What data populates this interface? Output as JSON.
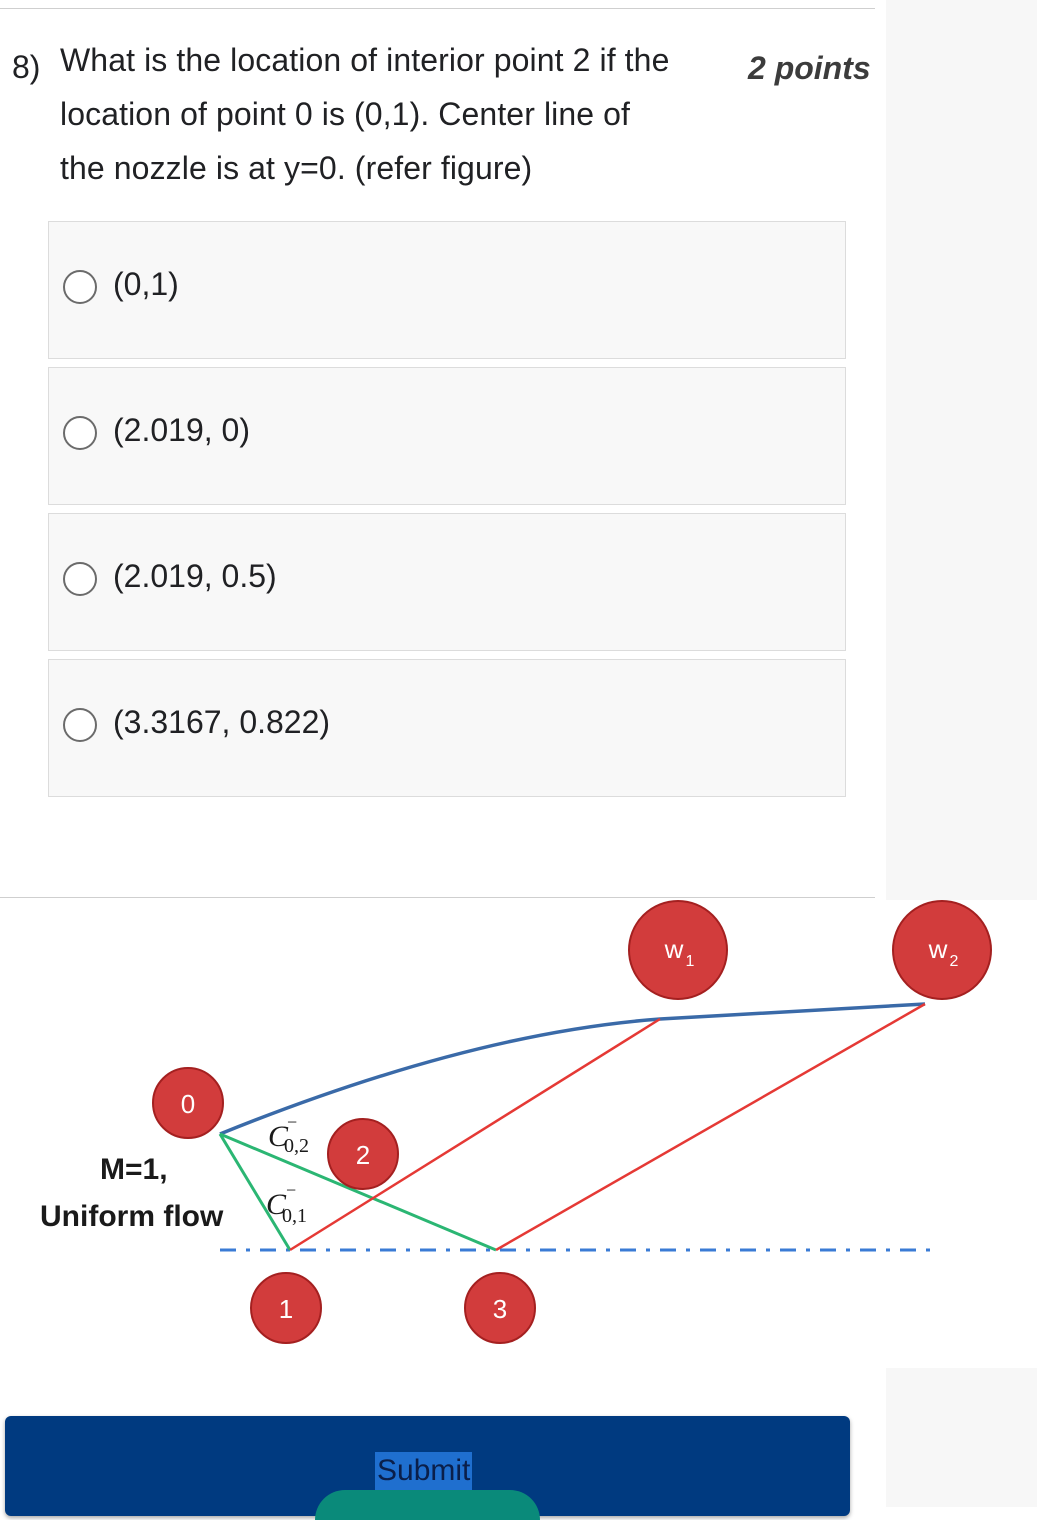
{
  "question": {
    "number": "8)",
    "lines": [
      "What is the location of interior point 2 if the",
      "location of point 0 is (0,1).  Center line of",
      "the nozzle is at y=0. (refer figure)"
    ],
    "points": "2 points"
  },
  "options": [
    {
      "label": "(0,1)"
    },
    {
      "label": "(2.019, 0)"
    },
    {
      "label": "(2.019, 0.5)"
    },
    {
      "label": "(3.3167, 0.822)"
    }
  ],
  "figure": {
    "inflow_label_1": "M=1,",
    "inflow_label_2": "Uniform flow",
    "point_labels": {
      "p0": "0",
      "p1": "1",
      "p2": "2",
      "p3": "3",
      "w1": "w",
      "w1_sub": "1",
      "w2": "w",
      "w2_sub": "2"
    },
    "char_labels": {
      "c02": "C",
      "c02_sub": "0,2",
      "c01": "C",
      "c01_sub": "0,1",
      "minus": "−"
    },
    "colors": {
      "wall": "#3a6aa8",
      "left_char": "#2bb673",
      "right_char": "#e53935",
      "centerline": "#3a7bd5",
      "point_fill": "#d23c3c",
      "point_stroke": "#a42020"
    }
  },
  "submit": {
    "label": "Submit"
  }
}
